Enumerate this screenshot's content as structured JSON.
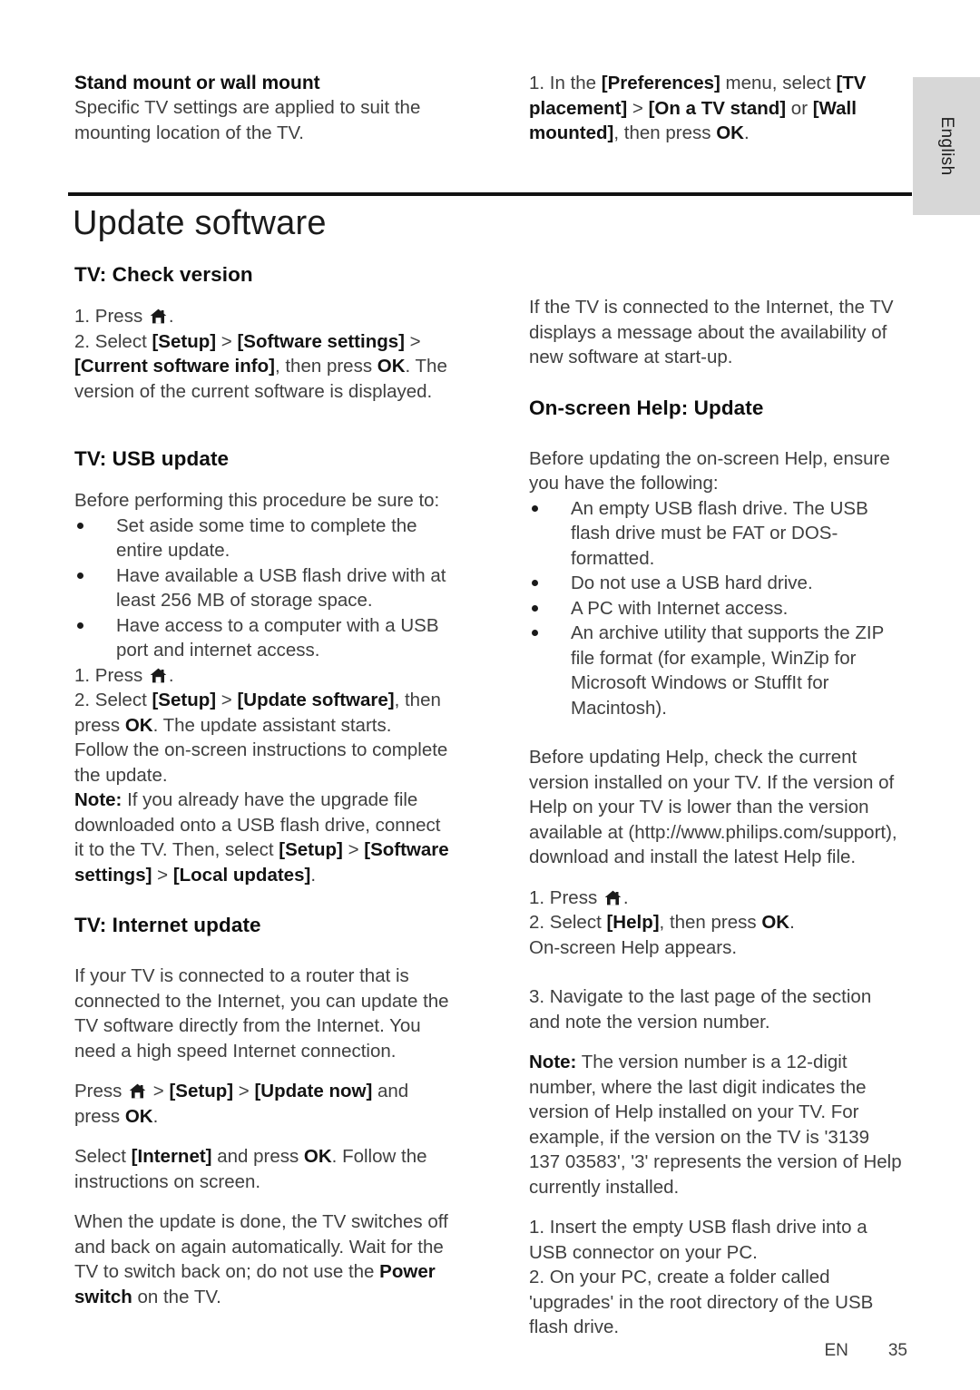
{
  "page": {
    "language_tab": "English",
    "title": "Update software",
    "footer_lang": "EN",
    "footer_page": "35",
    "home_icon_name": "home-icon"
  },
  "intro": {
    "left": {
      "heading": "Stand mount or wall mount",
      "body": "Specific TV settings are applied to suit the mounting location of the TV."
    },
    "right": {
      "step_prefix": "1. In the ",
      "pref_menu": "[Preferences]",
      "mid1": " menu, select ",
      "tv_placement": "[TV placement]",
      "gt1": " > ",
      "on_tv_stand": "[On a TV stand]",
      "or": " or ",
      "wall_mounted": "[Wall mounted]",
      "tail": ", then press ",
      "ok": "OK",
      "period": "."
    }
  },
  "left_column": {
    "check_version": {
      "heading": "TV: Check version",
      "step1_pre": "1. Press ",
      "step1_post": ".",
      "step2_pre": "2. Select ",
      "setup": "[Setup]",
      "gt1": " > ",
      "software_settings": "[Software settings]",
      "gt2": " > ",
      "current_software_info": "[Current software info]",
      "mid": ", then press ",
      "ok": "OK",
      "tail": ". The version of the current software is displayed."
    },
    "usb_update": {
      "heading": "TV: USB update",
      "intro": "Before performing this procedure be sure to:",
      "bullets": [
        "Set aside some time to complete the entire update.",
        "Have available a USB flash drive with at least 256 MB of storage space.",
        "Have access to a computer with a USB port and internet access."
      ],
      "step1_pre": "1. Press ",
      "step1_post": ".",
      "step2_pre": "2. Select ",
      "setup": "[Setup]",
      "gt1": " > ",
      "update_software": "[Update software]",
      "mid1": ", then press ",
      "ok": "OK",
      "mid2": ". The update assistant starts. Follow the on-screen instructions to complete the update.",
      "note_label": "Note:",
      "note_body1": " If you already have the upgrade file downloaded onto a USB flash drive, connect it to the TV. Then, select ",
      "note_setup": "[Setup]",
      "note_gt1": " > ",
      "note_software_settings": "[Software settings]",
      "note_gt2": " > ",
      "note_local_updates": "[Local updates]",
      "note_tail": "."
    },
    "internet_update": {
      "heading": "TV: Internet update",
      "para1": "If your TV is connected to a router that is connected to the Internet, you can update the TV software directly from the Internet. You need a high speed Internet connection.",
      "press_pre": "Press ",
      "gt1": " > ",
      "setup": "[Setup]",
      "gt2": " > ",
      "update_now": "[Update now]",
      "and": " and press ",
      "ok": "OK",
      "period": ".",
      "para3_pre": "Select ",
      "internet": "[Internet]",
      "para3_mid": " and press ",
      "para3_ok": "OK",
      "para3_tail": ". Follow the instructions on screen.",
      "para4_pre": "When the update is done, the TV switches off and back on again automatically. Wait for the TV to switch back on; do not use the ",
      "power_switch": "Power switch",
      "para4_tail": " on the TV."
    }
  },
  "right_column": {
    "internet_msg": "If the TV is connected to the Internet, the TV displays a message about the availability of new software at start-up.",
    "onscreen_help": {
      "heading": "On-screen Help: Update",
      "intro": "Before updating the on-screen Help, ensure you have the following:",
      "bullets": [
        "An empty USB flash drive. The USB flash drive must be FAT or DOS-formatted.",
        "Do not use a USB hard drive.",
        "A PC with Internet access.",
        "An archive utility that supports the ZIP file format (for example, WinZip for Microsoft Windows or StuffIt for Macintosh)."
      ],
      "before_update": "Before updating Help, check the current version installed on your TV. If the version of Help on your TV is lower than the version available at (http://www.philips.com/support), download and install the latest Help file.",
      "step1_pre": "1. Press ",
      "step1_post": ".",
      "step2_pre": "2. Select ",
      "help": "[Help]",
      "step2_mid": ", then press ",
      "step2_ok": "OK",
      "step2_tail": ".",
      "step2_extra": "On-screen Help appears.",
      "step3": "3. Navigate to the last page of the section and note the version number.",
      "note_label": "Note:",
      "note_body": " The version number is a 12-digit number, where the last digit indicates the version of Help installed on your TV. For example, if the version on the TV is '3139 137 03583', '3' represents the version of Help currently installed.",
      "final_step1": "1. Insert the empty USB flash drive into a USB connector on your PC.",
      "final_step2": "2. On your PC, create a folder called 'upgrades' in the root directory of the USB flash drive."
    }
  }
}
